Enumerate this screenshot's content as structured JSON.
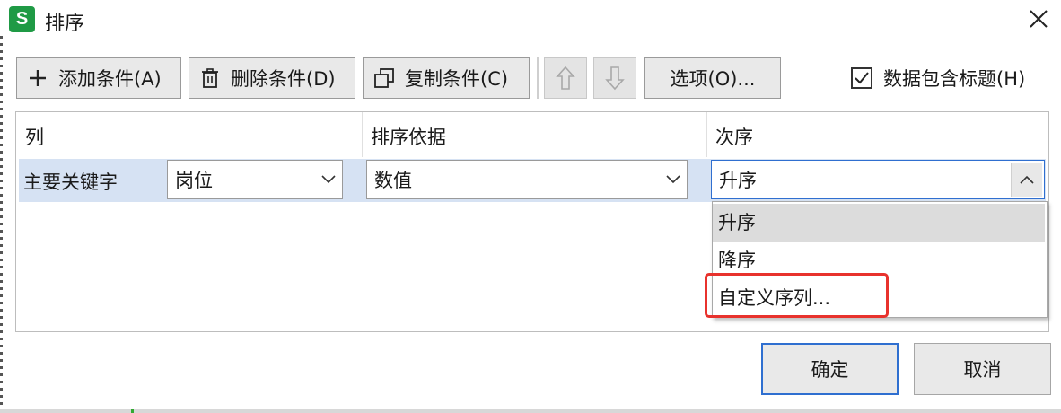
{
  "window": {
    "title": "排序",
    "app_icon_letter": "S",
    "app_icon_color": "#1f9a45"
  },
  "toolbar": {
    "add_label": "添加条件(A)",
    "delete_label": "删除条件(D)",
    "copy_label": "复制条件(C)",
    "options_label": "选项(O)...",
    "header_checkbox_label": "数据包含标题(H)",
    "header_checkbox_checked": true
  },
  "grid": {
    "headers": [
      "列",
      "排序依据",
      "次序"
    ],
    "row": {
      "label": "主要关键字",
      "column_value": "岗位",
      "basis_value": "数值",
      "order_value": "升序"
    }
  },
  "dropdown": {
    "items": [
      "升序",
      "降序",
      "自定义序列..."
    ],
    "highlighted_index": 0,
    "annotated_index": 2,
    "annotation_color": "#e8322d"
  },
  "buttons": {
    "ok_label": "确定",
    "cancel_label": "取消"
  },
  "colors": {
    "selection": "#d6e2f3",
    "focus_border": "#2f6fd0"
  }
}
